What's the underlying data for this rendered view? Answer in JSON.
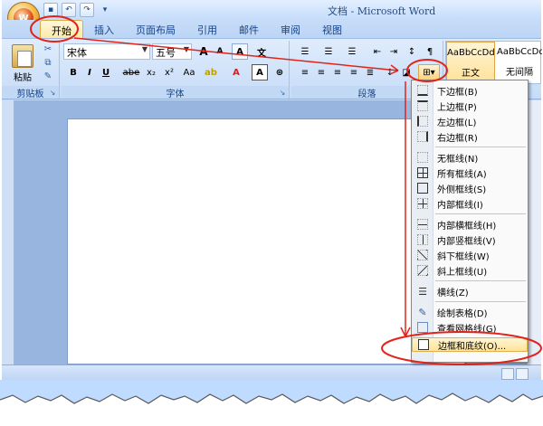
{
  "window": {
    "title": "文档 - Microsoft Word",
    "office_button_label": "W"
  },
  "quick_access": [
    "save-icon",
    "undo-icon",
    "redo-icon",
    "customize-icon"
  ],
  "tabs": [
    {
      "label": "开始",
      "active": true
    },
    {
      "label": "插入"
    },
    {
      "label": "页面布局"
    },
    {
      "label": "引用"
    },
    {
      "label": "邮件"
    },
    {
      "label": "审阅"
    },
    {
      "label": "视图"
    }
  ],
  "ribbon": {
    "clipboard": {
      "paste_label": "粘贴",
      "group_label": "剪贴板"
    },
    "font": {
      "font_name": "宋体",
      "font_size": "五号",
      "group_label": "字体",
      "bold": "B",
      "italic": "I",
      "underline": "U",
      "strikethrough": "abe",
      "subscript": "x₂",
      "superscript": "x²",
      "change_case": "Aa",
      "grow": "A",
      "shrink": "A",
      "clear": "A",
      "char_border": "A"
    },
    "paragraph": {
      "group_label": "段落"
    },
    "styles": {
      "items": [
        {
          "sample": "AaBbCcDd",
          "name": "正文"
        },
        {
          "sample": "AaBbCcDd",
          "name": "无间隔"
        }
      ]
    }
  },
  "border_menu": {
    "items": [
      {
        "label": "下边框(B)",
        "icon": "bottom-border-icon"
      },
      {
        "label": "上边框(P)",
        "icon": "top-border-icon"
      },
      {
        "label": "左边框(L)",
        "icon": "left-border-icon"
      },
      {
        "label": "右边框(R)",
        "icon": "right-border-icon"
      },
      {
        "label": "无框线(N)",
        "icon": "no-border-icon"
      },
      {
        "label": "所有框线(A)",
        "icon": "all-borders-icon"
      },
      {
        "label": "外侧框线(S)",
        "icon": "outside-borders-icon"
      },
      {
        "label": "内部框线(I)",
        "icon": "inside-borders-icon"
      },
      {
        "label": "内部横框线(H)",
        "icon": "inside-horizontal-border-icon"
      },
      {
        "label": "内部竖框线(V)",
        "icon": "inside-vertical-border-icon"
      },
      {
        "label": "斜下框线(W)",
        "icon": "diagonal-down-border-icon"
      },
      {
        "label": "斜上框线(U)",
        "icon": "diagonal-up-border-icon"
      },
      {
        "label": "横线(Z)",
        "icon": "horizontal-line-icon"
      },
      {
        "label": "绘制表格(D)",
        "icon": "draw-table-icon"
      },
      {
        "label": "查看网格线(G)",
        "icon": "view-gridlines-icon"
      },
      {
        "label": "边框和底纹(O)...",
        "icon": "borders-shading-icon"
      }
    ]
  },
  "colors": {
    "annotation_red": "#e2231a",
    "highlight": "#ffe28c"
  }
}
